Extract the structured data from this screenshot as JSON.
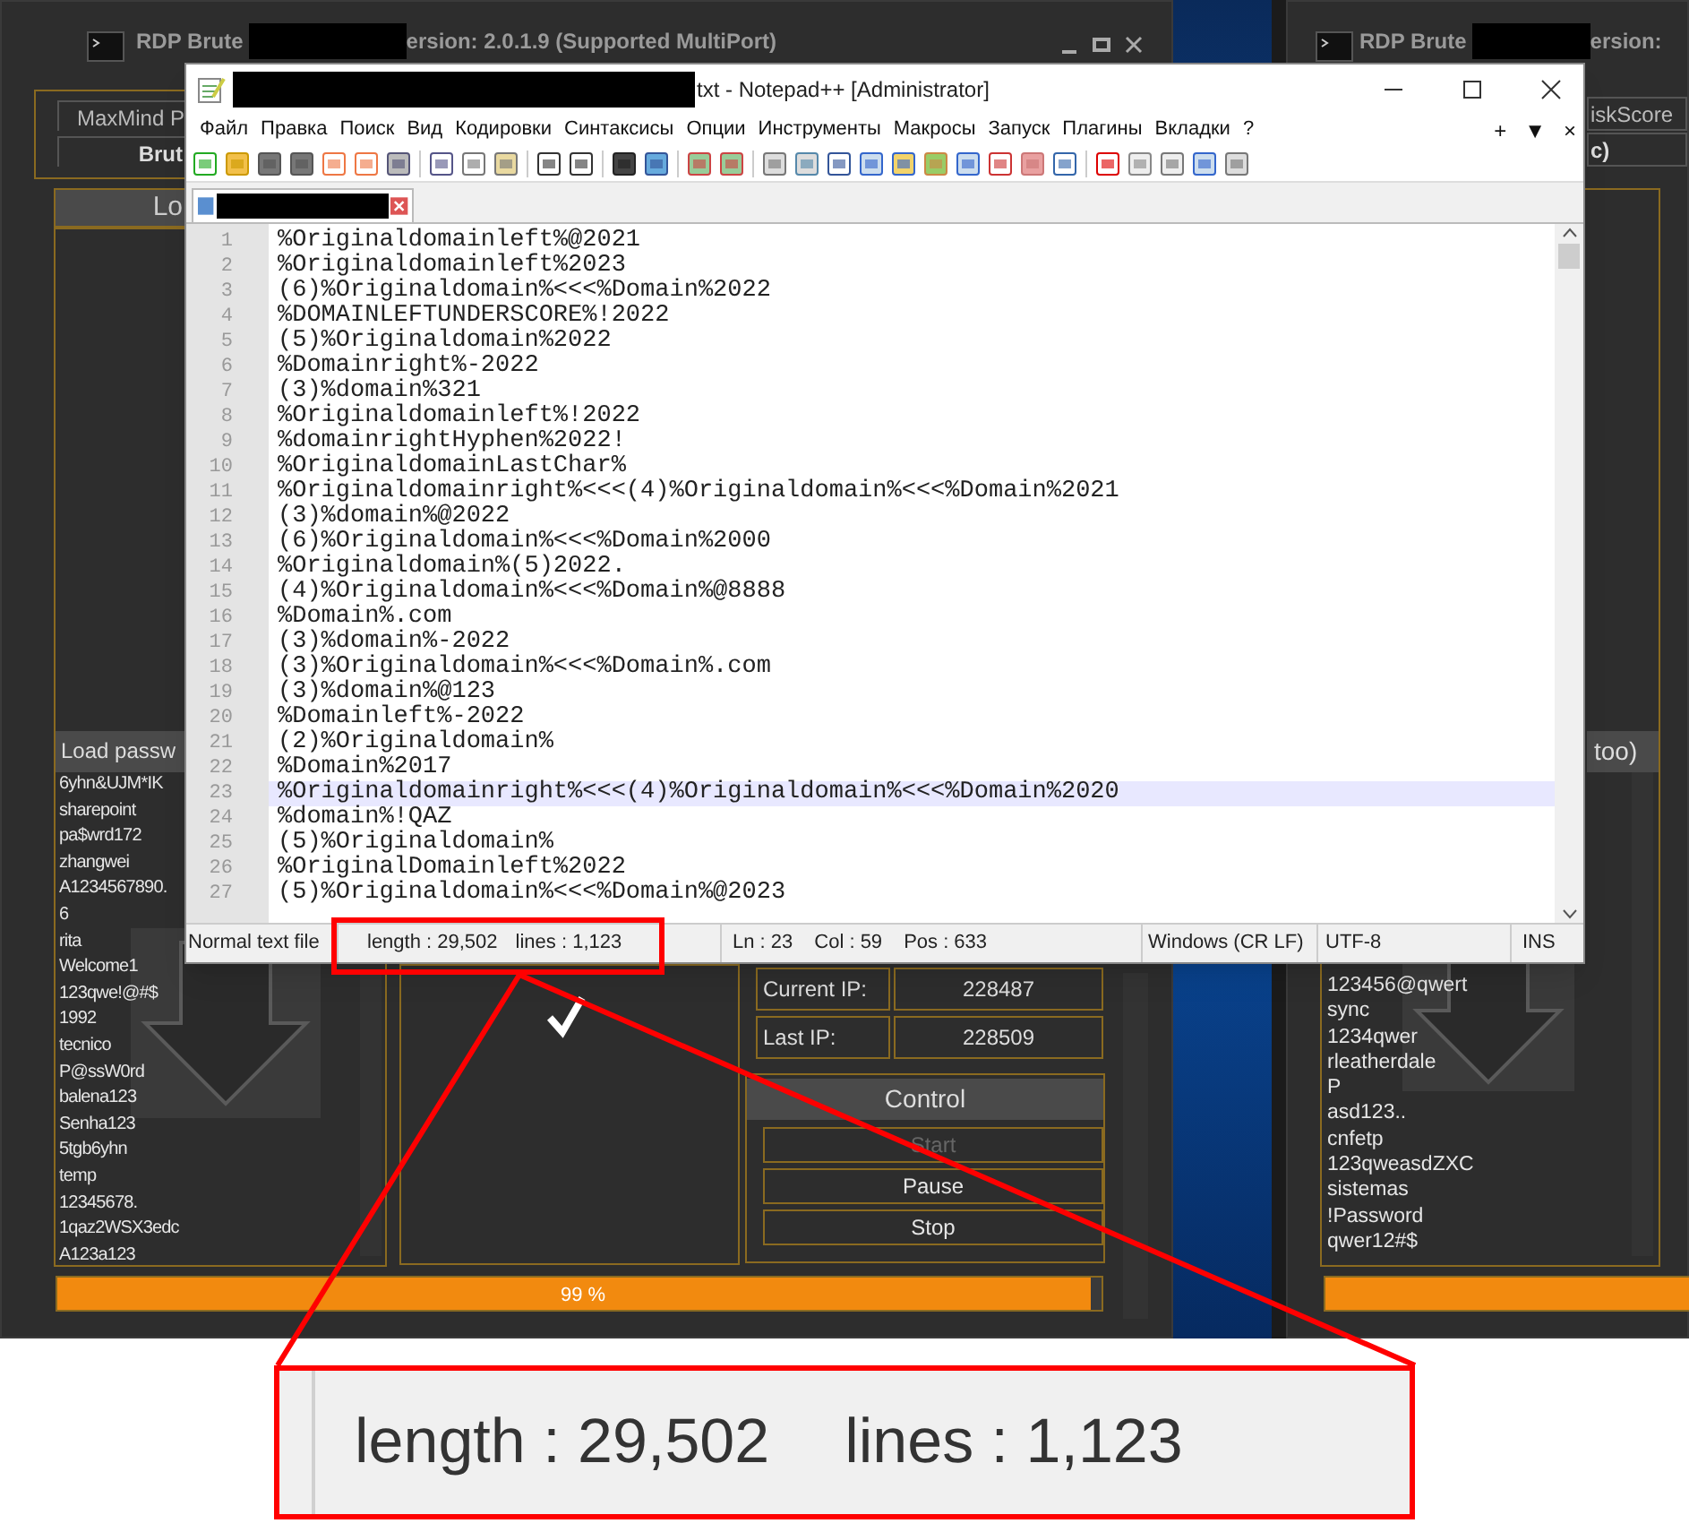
{
  "rdp_left": {
    "title_prefix": "RDP Brute",
    "title_suffix": "ersion: 2.0.1.9 (Supported MultiPort)",
    "buttons": [
      "MaxMind P",
      "Brut"
    ],
    "panel_header": "Lo",
    "list_header": "Load passw",
    "passwords": [
      "6yhn&UJM*IK",
      "sharepoint",
      "pa$wrd172",
      "zhangwei",
      "A1234567890.",
      "6",
      "rita",
      "Welcome1",
      "123qwe!@#$",
      "1992",
      "tecnico",
      "P@ssW0rd",
      "balena123",
      "Senha123",
      "5tgb6yhn",
      "temp",
      "12345678.",
      "1qaz2WSX3edc",
      "A123a123"
    ],
    "stats": [
      {
        "label": "Current IP:",
        "value": "228487"
      },
      {
        "label": "Last IP:",
        "value": "228509"
      }
    ],
    "control_header": "Control",
    "controls": [
      {
        "label": "Start",
        "disabled": true
      },
      {
        "label": "Pause",
        "disabled": false
      },
      {
        "label": "Stop",
        "disabled": false
      }
    ],
    "progress": {
      "level": 0.99,
      "text": "99 %"
    }
  },
  "rdp_right": {
    "title_prefix": "RDP Brute",
    "title_suffix": "ersion:",
    "buttons": [
      "iskScore",
      "c)"
    ],
    "list_header": "too)",
    "passwords": [
      "123456@qwert",
      "sync",
      "1234qwer",
      "rleatherdale",
      "P",
      "asd123..",
      "cnfetp",
      "123qweasdZXC",
      "sistemas",
      "!Password",
      "qwer12#$"
    ],
    "progress": {
      "level": 1
    }
  },
  "notepad": {
    "title": "txt - Notepad++ [Administrator]",
    "menu": [
      "Файл",
      "Правка",
      "Поиск",
      "Вид",
      "Кодировки",
      "Синтаксисы",
      "Опции",
      "Инструменты",
      "Макросы",
      "Запуск",
      "Плагины",
      "Вкладки",
      "?"
    ],
    "menu_right": [
      "+",
      "▼",
      "×"
    ],
    "lines": [
      {
        "number": "1",
        "text": "%Originaldomainleft%@2021",
        "selected": false
      },
      {
        "number": "2",
        "text": "%Originaldomainleft%2023",
        "selected": false
      },
      {
        "number": "3",
        "text": "(6)%Originaldomain%<<<%Domain%2022",
        "selected": false
      },
      {
        "number": "4",
        "text": "%DOMAINLEFTUNDERSCORE%!2022",
        "selected": false
      },
      {
        "number": "5",
        "text": "(5)%Originaldomain%2022",
        "selected": false
      },
      {
        "number": "6",
        "text": "%Domainright%-2022",
        "selected": false
      },
      {
        "number": "7",
        "text": "(3)%domain%321",
        "selected": false
      },
      {
        "number": "8",
        "text": "%Originaldomainleft%!2022",
        "selected": false
      },
      {
        "number": "9",
        "text": "%domainrightHyphen%2022!",
        "selected": false
      },
      {
        "number": "10",
        "text": "%OriginaldomainLastChar%",
        "selected": false
      },
      {
        "number": "11",
        "text": "%Originaldomainright%<<<(4)%Originaldomain%<<<%Domain%2021",
        "selected": false
      },
      {
        "number": "12",
        "text": "(3)%domain%@2022",
        "selected": false
      },
      {
        "number": "13",
        "text": "(6)%Originaldomain%<<<%Domain%2000",
        "selected": false
      },
      {
        "number": "14",
        "text": "%Originaldomain%(5)2022.",
        "selected": false
      },
      {
        "number": "15",
        "text": "(4)%Originaldomain%<<<%Domain%@8888",
        "selected": false
      },
      {
        "number": "16",
        "text": "%Domain%.com",
        "selected": false
      },
      {
        "number": "17",
        "text": "(3)%domain%-2022",
        "selected": false
      },
      {
        "number": "18",
        "text": "(3)%Originaldomain%<<<%Domain%.com",
        "selected": false
      },
      {
        "number": "19",
        "text": "(3)%domain%@123",
        "selected": false
      },
      {
        "number": "20",
        "text": "%Domainleft%-2022",
        "selected": false
      },
      {
        "number": "21",
        "text": "(2)%Originaldomain%",
        "selected": false
      },
      {
        "number": "22",
        "text": "%Domain%2017",
        "selected": false
      },
      {
        "number": "23",
        "text": "%Originaldomainright%<<<(4)%Originaldomain%<<<%Domain%2020",
        "selected": true
      },
      {
        "number": "24",
        "text": "%domain%!QAZ",
        "selected": false
      },
      {
        "number": "25",
        "text": "(5)%Originaldomain%",
        "selected": false
      },
      {
        "number": "26",
        "text": "%OriginalDomainleft%2022",
        "selected": false
      },
      {
        "number": "27",
        "text": "(5)%Originaldomain%<<<%Domain%@2023",
        "selected": false
      }
    ],
    "status_bar": {
      "file_type": "Normal text file",
      "length": "length : 29,502",
      "lines": "lines : 1,123",
      "ln": "Ln : 23",
      "col": "Col : 59",
      "pos": "Pos : 633",
      "eol": "Windows (CR LF)",
      "encoding": "UTF-8",
      "mode": "INS"
    }
  },
  "annotation": {
    "length": "length : 29,502",
    "lines": "lines : 1,123"
  }
}
